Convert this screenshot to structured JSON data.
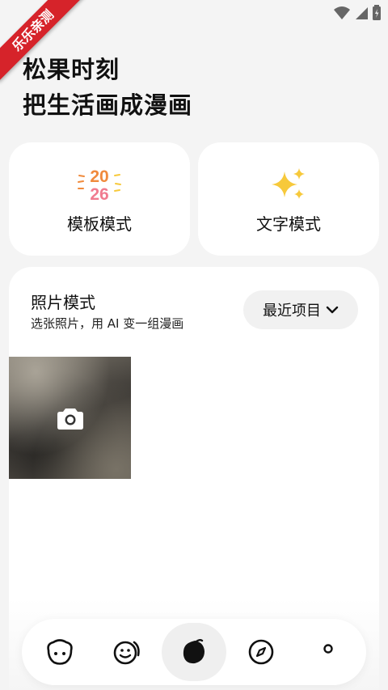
{
  "ribbon": {
    "text": "乐乐亲测"
  },
  "status_bar": {
    "icons": [
      "wifi-icon",
      "signal-icon",
      "battery-icon"
    ]
  },
  "header": {
    "line1": "松果时刻",
    "line2": "把生活画成漫画"
  },
  "modes": [
    {
      "label": "模板模式",
      "icon": "year-2026-icon",
      "icon_text_top": "20",
      "icon_text_bottom": "26"
    },
    {
      "label": "文字模式",
      "icon": "sparkle-icon"
    }
  ],
  "photo_mode": {
    "title": "照片模式",
    "subtitle": "选张照片，用 AI 变一组漫画",
    "album_button": "最近项目",
    "camera_tile_icon": "camera-icon"
  },
  "tab_bar": {
    "items": [
      {
        "icon": "mascot-head-icon"
      },
      {
        "icon": "smiley-icon"
      },
      {
        "icon": "pinecone-icon",
        "active": true
      },
      {
        "icon": "compass-icon"
      },
      {
        "icon": "dot-icon"
      }
    ]
  },
  "colors": {
    "accent_ribbon": "#d6232a",
    "sparkle": "#f7c93b",
    "year_orange": "#f08a3c",
    "year_pink": "#f07b8f"
  }
}
